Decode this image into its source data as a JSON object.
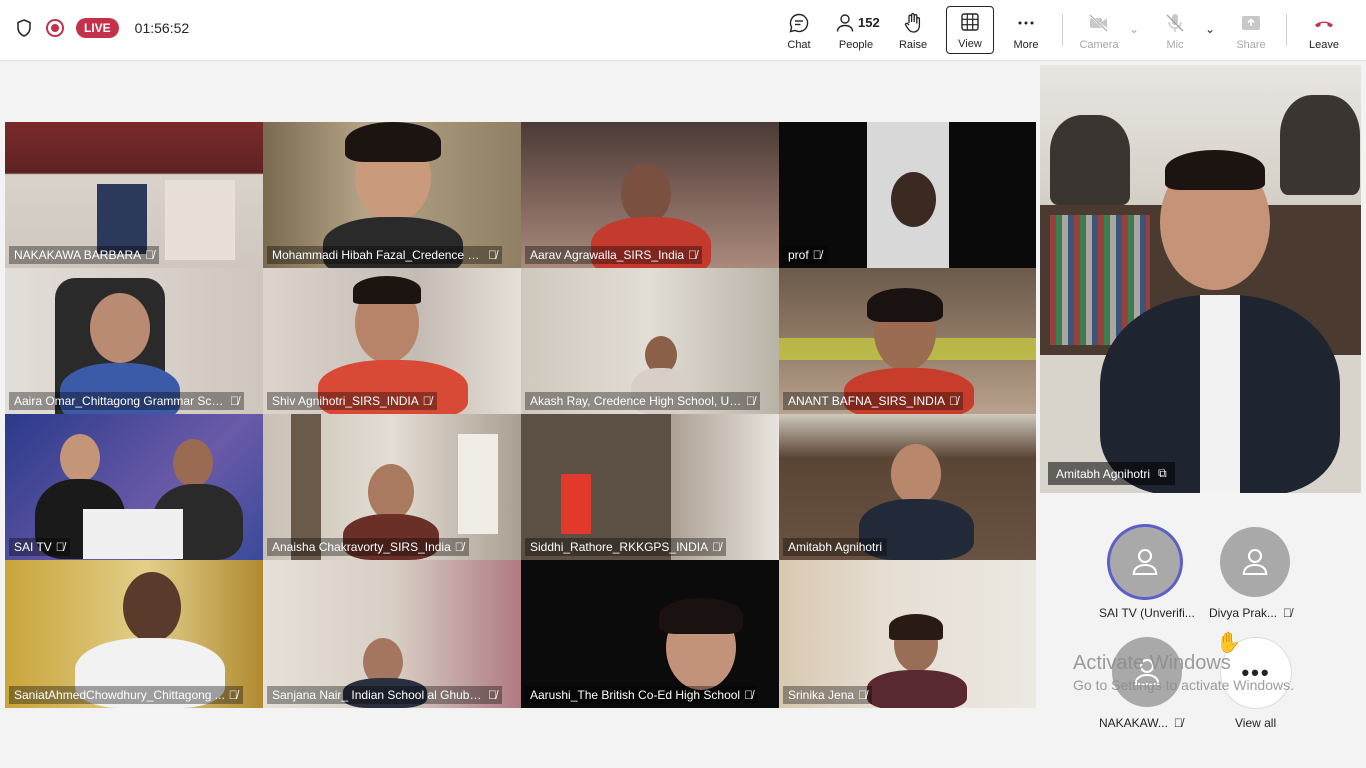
{
  "topbar": {
    "live_label": "LIVE",
    "timer": "01:56:52",
    "tools": {
      "chat": "Chat",
      "people": "People",
      "people_count": "152",
      "raise": "Raise",
      "view": "View",
      "more": "More",
      "camera": "Camera",
      "mic": "Mic",
      "share": "Share",
      "leave": "Leave"
    }
  },
  "tiles": [
    "NAKAKAWA BARBARA",
    "Mohammadi Hibah Fazal_Credence Hi...",
    "Aarav Agrawalla_SIRS_India",
    "prof",
    "Aaira Omar_Chittagong Grammar Scho...",
    "Shiv Agnihotri_SIRS_INDIA",
    "Akash Ray, Credence High School, UAE",
    "ANANT BAFNA_SIRS_INDIA",
    "SAI TV",
    "Anaisha Chakravorty_SIRS_India",
    "Siddhi_Rathore_RKKGPS_INDIA",
    "Amitabh Agnihotri",
    "SaniatAhmedChowdhury_Chittagong ...",
    "Sanjana Nair_ Indian School al Ghubra...",
    "Aarushi_The British Co-Ed High School",
    "Srinika Jena"
  ],
  "spotlight": {
    "name": "Amitabh Agnihotri"
  },
  "avatars": {
    "a1": "SAI TV (Unverifi...",
    "a2": "Divya Prak...",
    "a3": "NAKAKAW...",
    "view_all": "View all"
  },
  "watermark": {
    "line1": "Activate Windows",
    "line2": "Go to Settings to activate Windows."
  },
  "colors": {
    "live": "#c4314b",
    "leave": "#c4314b",
    "accent": "#5b5fc7"
  }
}
